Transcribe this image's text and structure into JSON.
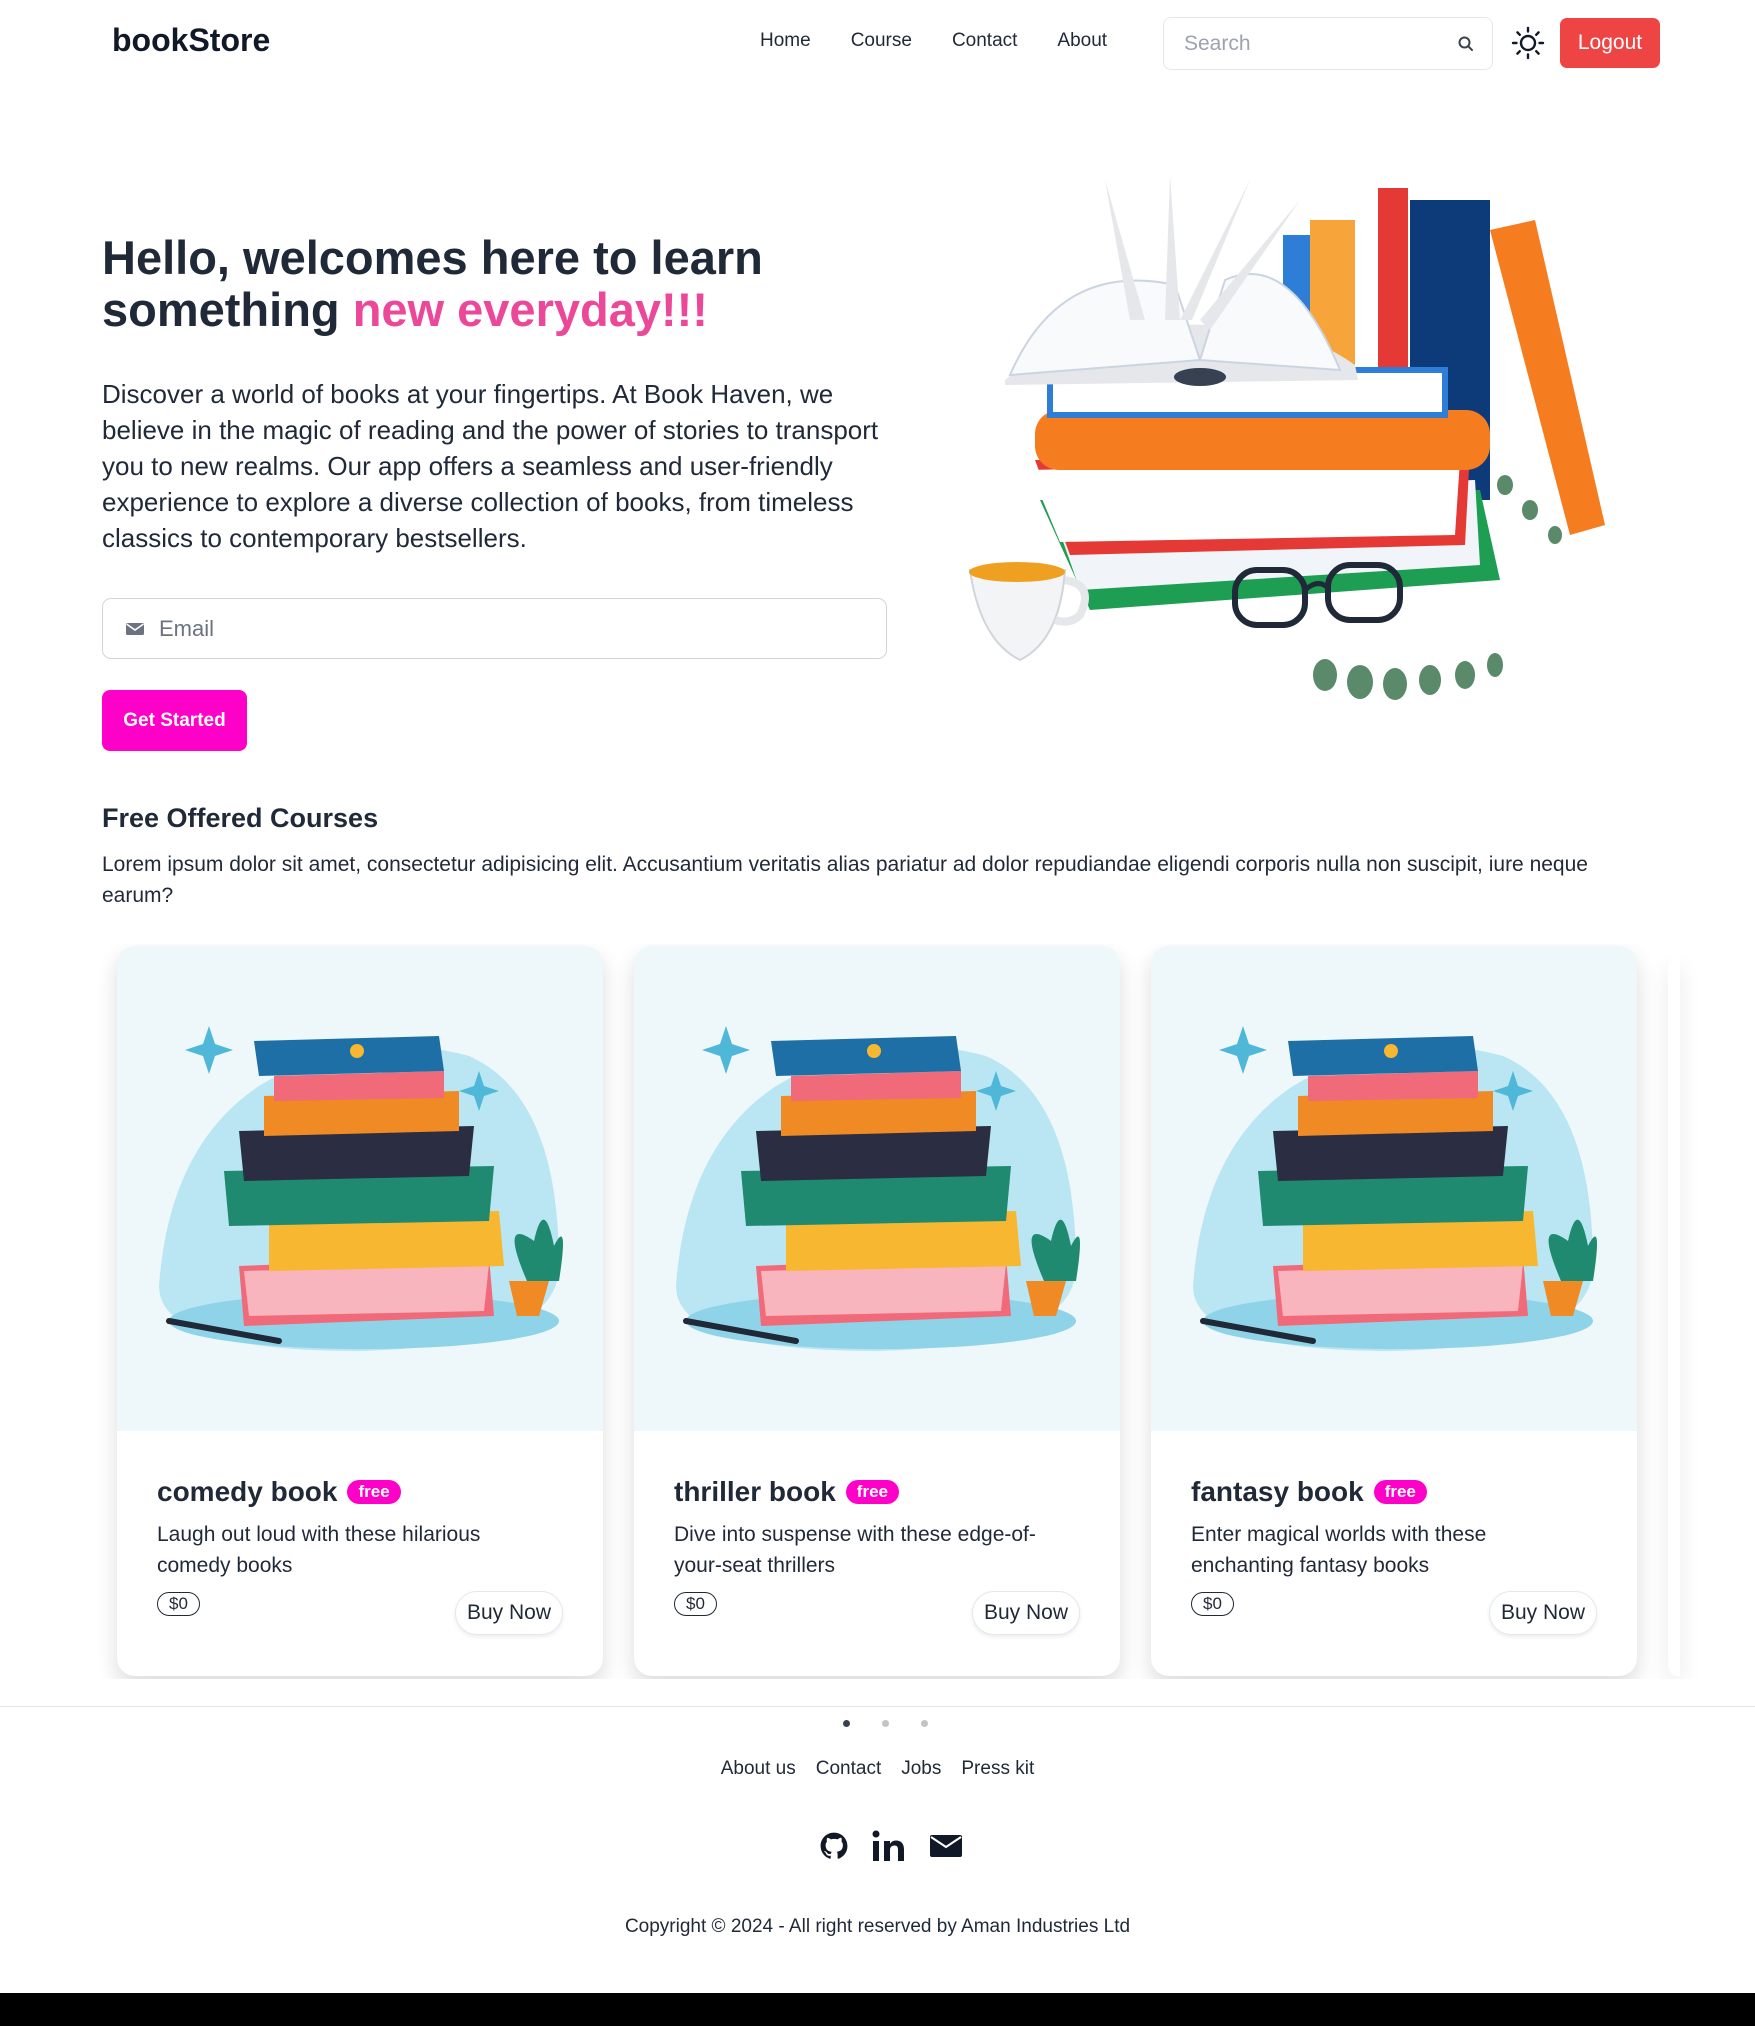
{
  "navbar": {
    "brand": "bookStore",
    "links": [
      "Home",
      "Course",
      "Contact",
      "About"
    ],
    "search_placeholder": "Search",
    "logout_label": "Logout"
  },
  "hero": {
    "title_part1": "Hello, welcomes here to learn something ",
    "title_accent": "new everyday!!!",
    "description": "Discover a world of books at your fingertips. At Book Haven, we believe in the magic of reading and the power of stories to transport you to new realms. Our app offers a seamless and user-friendly experience to explore a diverse collection of books, from timeless classics to contemporary bestsellers.",
    "email_placeholder": "Email",
    "cta_label": "Get Started"
  },
  "courses": {
    "title": "Free Offered Courses",
    "description": "Lorem ipsum dolor sit amet, consectetur adipisicing elit. Accusantium veritatis alias pariatur ad dolor repudiandae eligendi corporis nulla non suscipit, iure neque earum?",
    "cards": [
      {
        "title": "comedy book",
        "badge": "free",
        "description": "Laugh out loud with these hilarious comedy books",
        "price": "$0",
        "button": "Buy Now"
      },
      {
        "title": "thriller book",
        "badge": "free",
        "description": "Dive into suspense with these edge-of-your-seat thrillers",
        "price": "$0",
        "button": "Buy Now"
      },
      {
        "title": "fantasy book",
        "badge": "free",
        "description": "Enter magical worlds with these enchanting fantasy books",
        "price": "$0",
        "button": "Buy Now"
      }
    ],
    "carousel_pages": 3,
    "carousel_active": 1
  },
  "footer": {
    "links": [
      "About us",
      "Contact",
      "Jobs",
      "Press kit"
    ],
    "social_icons": [
      "github-icon",
      "linkedin-icon",
      "mail-icon"
    ],
    "copyright": "Copyright © 2024 - All right reserved by Aman Industries Ltd"
  },
  "colors": {
    "accent_pink": "#ec4899",
    "button_magenta": "#ff00c8",
    "logout_red": "#ef4444"
  }
}
